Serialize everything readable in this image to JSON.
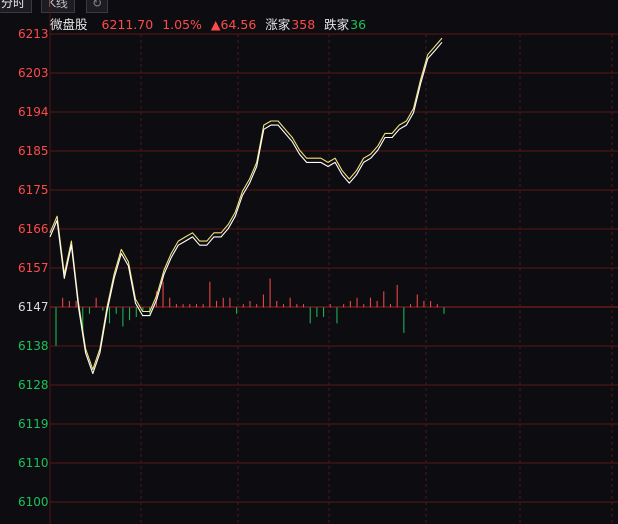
{
  "tabs": {
    "fenshi": "分时",
    "kline": "K线",
    "refresh_icon": "refresh-icon"
  },
  "header": {
    "name": "微盘股",
    "price": "6211.70",
    "pct": "1.05%",
    "change": "▲64.56",
    "up_label": "涨家",
    "up_count": "358",
    "down_label": "跌家",
    "down_count": "36"
  },
  "colors": {
    "up": "#ff4a4a",
    "down": "#19c25a",
    "line": "#f2e27a",
    "grid": "#5a1616",
    "bg": "#0d0d11"
  },
  "chart_data": {
    "type": "line",
    "yticks": [
      "6213",
      "6203",
      "6194",
      "6185",
      "6175",
      "6166",
      "6157",
      "6147",
      "6138",
      "6128",
      "6119",
      "6110",
      "6100"
    ],
    "tick_colors": [
      "up",
      "up",
      "up",
      "up",
      "up",
      "up",
      "up",
      "neutral",
      "down",
      "down",
      "down",
      "down",
      "down"
    ],
    "ylim": [
      6100,
      6213
    ],
    "prev_close": 6147,
    "series": [
      {
        "values": [
          6165,
          6169,
          6155,
          6163,
          6148,
          6137,
          6132,
          6137,
          6147,
          6155,
          6161,
          6158,
          6149,
          6146,
          6146,
          6150,
          6156,
          6160,
          6163,
          6164,
          6165,
          6163,
          6163,
          6165,
          6165,
          6167,
          6170,
          6175,
          6178,
          6182,
          6191,
          6192,
          6192,
          6190,
          6188,
          6185,
          6183,
          6183,
          6183,
          6182,
          6183,
          6180,
          6178,
          6180,
          6183,
          6184,
          6186,
          6189,
          6189,
          6191,
          6192,
          6195,
          6202,
          6208,
          6210,
          6212
        ]
      },
      {
        "values": [
          6164,
          6168,
          6154,
          6162,
          6147,
          6136,
          6131,
          6136,
          6146,
          6154,
          6160,
          6157,
          6148,
          6145,
          6145,
          6149,
          6155,
          6159,
          6162,
          6163,
          6164,
          6162,
          6162,
          6164,
          6164,
          6166,
          6169,
          6174,
          6177,
          6181,
          6190,
          6191,
          6191,
          6189,
          6187,
          6184,
          6182,
          6182,
          6182,
          6181,
          6182,
          6179,
          6177,
          6179,
          6182,
          6183,
          6185,
          6188,
          6188,
          6190,
          6191,
          6194,
          6201,
          6207,
          6209,
          6211
        ]
      }
    ],
    "volume": [
      -12,
      3,
      2,
      2,
      -8,
      -2,
      3,
      -1,
      -5,
      -2,
      -6,
      -4,
      -3,
      -1,
      -2,
      5,
      8,
      3,
      1,
      1,
      1,
      1,
      1,
      8,
      2,
      3,
      3,
      -2,
      1,
      2,
      1,
      4,
      9,
      2,
      1,
      3,
      1,
      1,
      -5,
      -3,
      -3,
      1,
      -5,
      1,
      2,
      3,
      1,
      3,
      2,
      5,
      1,
      7,
      -8,
      1,
      4,
      2,
      2,
      1,
      -2
    ]
  }
}
